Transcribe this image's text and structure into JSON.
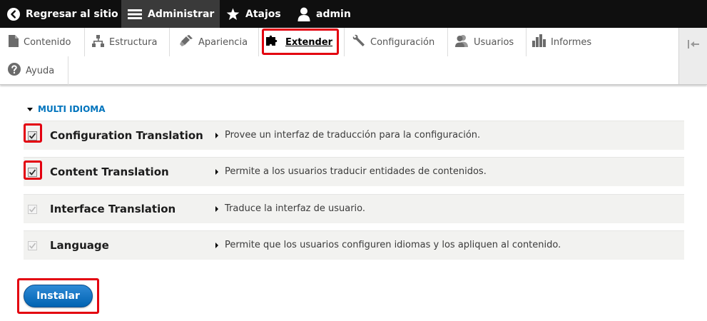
{
  "toolbar": {
    "back_label": "Regresar al sitio",
    "manage_label": "Administrar",
    "shortcuts_label": "Atajos",
    "user_label": "admin"
  },
  "tray": {
    "tabs": [
      {
        "label": "Contenido",
        "icon": "document-icon"
      },
      {
        "label": "Estructura",
        "icon": "hierarchy-icon"
      },
      {
        "label": "Apariencia",
        "icon": "paint-icon"
      },
      {
        "label": "Extender",
        "icon": "puzzle-icon",
        "active": true
      },
      {
        "label": "Configuración",
        "icon": "wrench-icon"
      },
      {
        "label": "Usuarios",
        "icon": "people-icon"
      },
      {
        "label": "Informes",
        "icon": "bar-chart-icon"
      },
      {
        "label": "Ayuda",
        "icon": "help-icon"
      }
    ]
  },
  "package": {
    "title": "MULTI IDIOMA",
    "modules": [
      {
        "name": "Configuration Translation",
        "description": "Provee un interfaz de traducción para la configuración.",
        "checked": true,
        "disabled": false
      },
      {
        "name": "Content Translation",
        "description": "Permite a los usuarios traducir entidades de contenidos.",
        "checked": true,
        "disabled": false
      },
      {
        "name": "Interface Translation",
        "description": "Traduce la interfaz de usuario.",
        "checked": true,
        "disabled": true
      },
      {
        "name": "Language",
        "description": "Permite que los usuarios configuren idiomas y los apliquen al contenido.",
        "checked": true,
        "disabled": true
      }
    ]
  },
  "actions": {
    "install_label": "Instalar"
  },
  "colors": {
    "link": "#0074bd",
    "highlight": "#e3000f",
    "button": "#0071c5",
    "toolbar": "#0f0f0f"
  }
}
